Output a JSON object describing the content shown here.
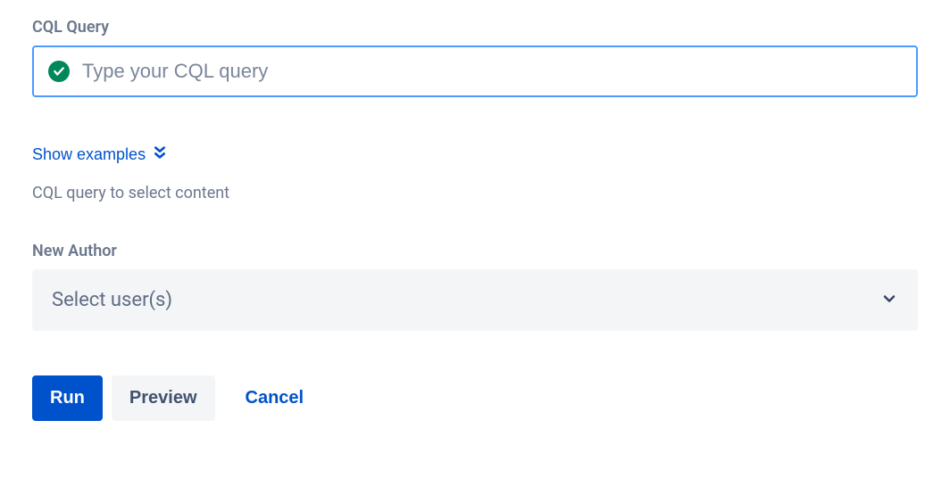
{
  "cql": {
    "label": "CQL Query",
    "placeholder": "Type your CQL query",
    "value": "",
    "showExamples": "Show examples",
    "helper": "CQL query to select content"
  },
  "newAuthor": {
    "label": "New Author",
    "placeholder": "Select user(s)"
  },
  "buttons": {
    "run": "Run",
    "preview": "Preview",
    "cancel": "Cancel"
  }
}
